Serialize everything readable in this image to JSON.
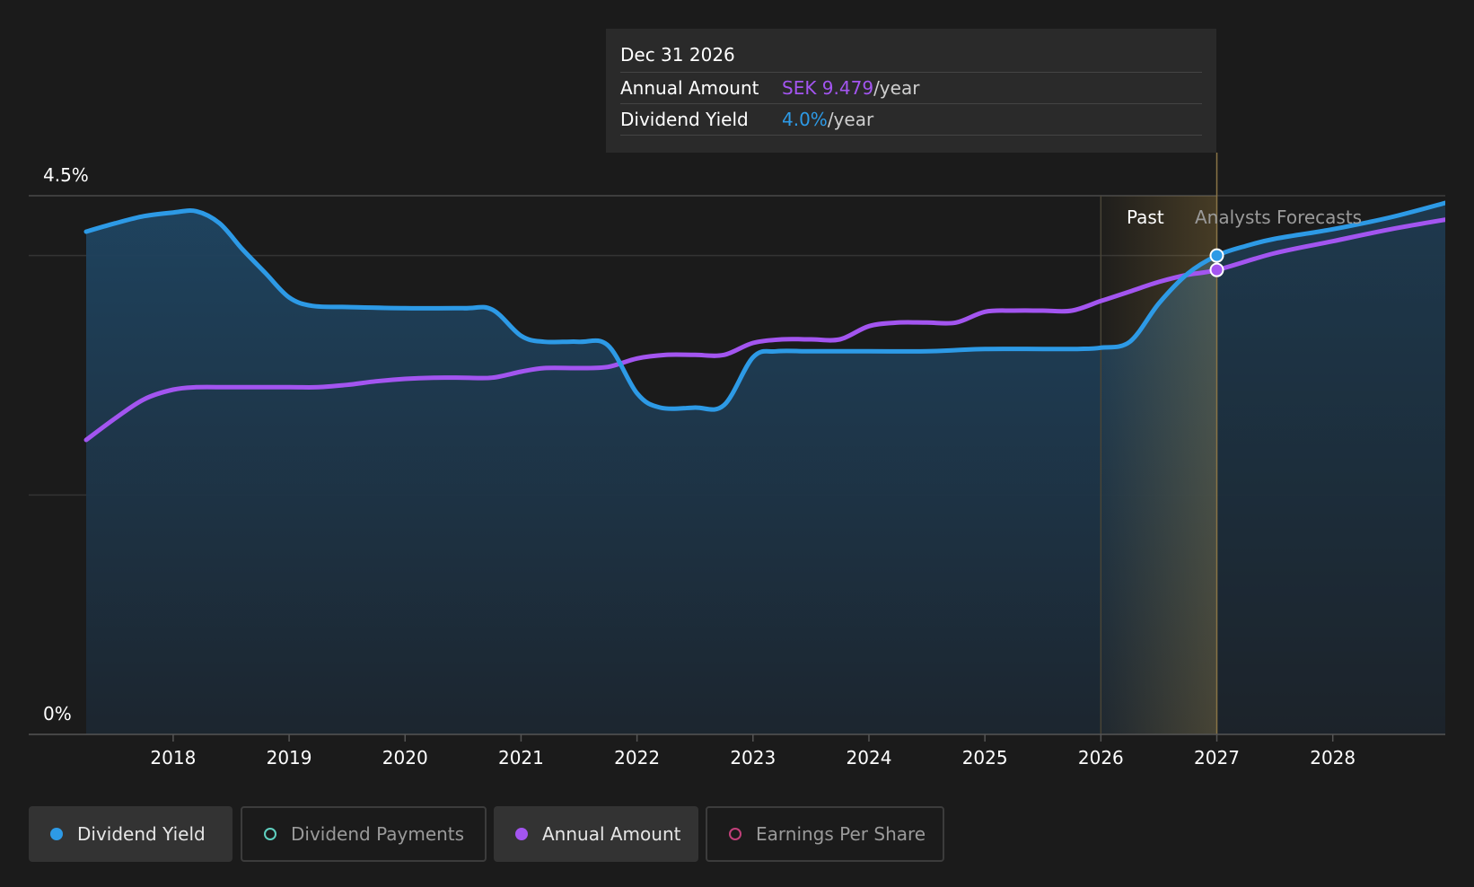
{
  "tooltip": {
    "date": "Dec 31 2026",
    "annual_label": "Annual Amount",
    "annual_value": "SEK 9.479",
    "annual_unit": "/year",
    "yield_label": "Dividend Yield",
    "yield_value": "4.0%",
    "yield_unit": "/year"
  },
  "labels": {
    "past": "Past",
    "forecast": "Analysts Forecasts"
  },
  "colors": {
    "dividend_yield": "#2d9ae6",
    "annual_amount": "#a355f0",
    "dividend_payments": "#5fd0c0",
    "earnings_per_share": "#c2407a",
    "background": "#1b1b1b"
  },
  "legend": [
    {
      "label": "Dividend Yield",
      "active": true,
      "color": "#2d9ae6",
      "icon": "filled-dot"
    },
    {
      "label": "Dividend Payments",
      "active": false,
      "color": "#5fd0c0",
      "icon": "hollow-dot"
    },
    {
      "label": "Annual Amount",
      "active": true,
      "color": "#a355f0",
      "icon": "filled-dot"
    },
    {
      "label": "Earnings Per Share",
      "active": false,
      "color": "#c2407a",
      "icon": "hollow-dot"
    }
  ],
  "chart_data": {
    "type": "line",
    "ylim": [
      0,
      4.5
    ],
    "y_tick_labels": [
      {
        "value": 4.5,
        "label": "4.5%"
      },
      {
        "value": 0,
        "label": "0%"
      }
    ],
    "y_gridlines": [
      4.5,
      4.0,
      2.0
    ],
    "x_range": [
      2017.25,
      2028.97
    ],
    "x_ticks": [
      "2018",
      "2019",
      "2020",
      "2021",
      "2022",
      "2023",
      "2024",
      "2025",
      "2026",
      "2027",
      "2028"
    ],
    "past_region": [
      2026.0,
      2027.0
    ],
    "highlight_x": 2027.0,
    "series": [
      {
        "name": "Dividend Yield",
        "unit": "%",
        "x": [
          2017.25,
          2017.5,
          2017.75,
          2018.0,
          2018.2,
          2018.4,
          2018.6,
          2018.8,
          2019.0,
          2019.2,
          2019.5,
          2020.0,
          2020.5,
          2020.75,
          2021.0,
          2021.2,
          2021.5,
          2021.75,
          2022.0,
          2022.2,
          2022.5,
          2022.75,
          2023.0,
          2023.2,
          2023.5,
          2024.0,
          2024.5,
          2024.75,
          2025.0,
          2025.5,
          2025.8,
          2026.0,
          2026.25,
          2026.5,
          2026.75,
          2027.0,
          2027.25,
          2027.5,
          2028.0,
          2028.5,
          2028.97
        ],
        "y": [
          4.2,
          4.27,
          4.33,
          4.36,
          4.37,
          4.27,
          4.05,
          3.85,
          3.65,
          3.58,
          3.57,
          3.56,
          3.56,
          3.55,
          3.33,
          3.28,
          3.28,
          3.25,
          2.85,
          2.73,
          2.73,
          2.75,
          3.15,
          3.2,
          3.2,
          3.2,
          3.2,
          3.21,
          3.22,
          3.22,
          3.22,
          3.23,
          3.28,
          3.6,
          3.85,
          4.0,
          4.08,
          4.14,
          4.22,
          4.32,
          4.44
        ]
      },
      {
        "name": "Annual Amount",
        "unit": "SEK",
        "axis_note": "plotted on the same visual scale",
        "x": [
          2017.25,
          2017.5,
          2017.75,
          2018.0,
          2018.2,
          2018.5,
          2019.0,
          2019.25,
          2019.5,
          2019.75,
          2020.0,
          2020.25,
          2020.5,
          2020.75,
          2021.0,
          2021.2,
          2021.5,
          2021.75,
          2022.0,
          2022.25,
          2022.5,
          2022.75,
          2023.0,
          2023.25,
          2023.5,
          2023.75,
          2024.0,
          2024.25,
          2024.5,
          2024.75,
          2025.0,
          2025.25,
          2025.5,
          2025.75,
          2026.0,
          2026.25,
          2026.5,
          2026.75,
          2027.0,
          2027.5,
          2028.0,
          2028.5,
          2028.97
        ],
        "y": [
          2.46,
          2.64,
          2.8,
          2.88,
          2.9,
          2.9,
          2.9,
          2.9,
          2.92,
          2.95,
          2.97,
          2.98,
          2.98,
          2.98,
          3.03,
          3.06,
          3.06,
          3.07,
          3.14,
          3.17,
          3.17,
          3.17,
          3.27,
          3.3,
          3.3,
          3.3,
          3.41,
          3.44,
          3.44,
          3.44,
          3.53,
          3.54,
          3.54,
          3.54,
          3.62,
          3.7,
          3.78,
          3.84,
          3.88,
          4.02,
          4.12,
          4.22,
          4.3
        ]
      }
    ]
  }
}
